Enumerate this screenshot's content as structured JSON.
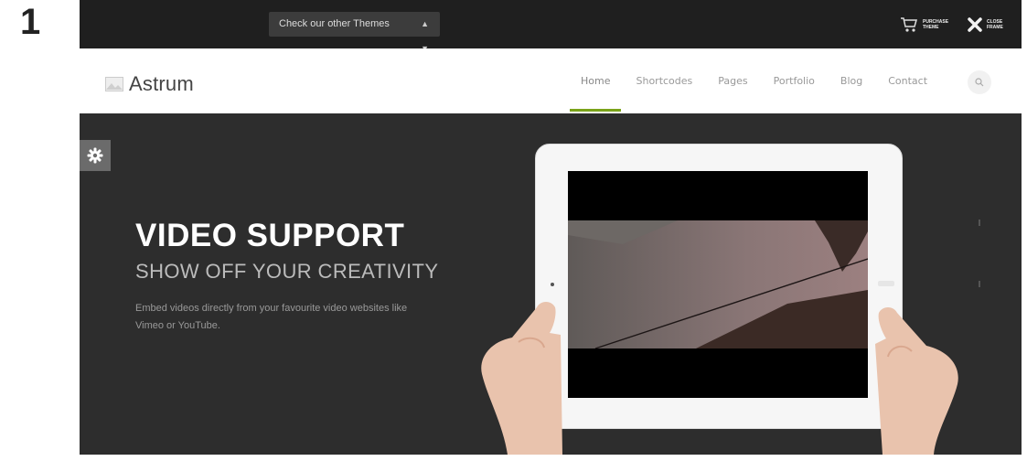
{
  "figure_number": "1",
  "topbar": {
    "theme_select_value": "Check our other Themes",
    "purchase_label": "PURCHASE THEME",
    "close_label": "CLOSE FRAME"
  },
  "header": {
    "logo_text": "Astrum",
    "nav": [
      "Home",
      "Shortcodes",
      "Pages",
      "Portfolio",
      "Blog",
      "Contact"
    ],
    "active_nav": "Home"
  },
  "hero": {
    "title": "VIDEO SUPPORT",
    "subtitle": "SHOW OFF YOUR CREATIVITY",
    "description": "Embed videos directly from your favourite video websites like Vimeo or YouTube."
  },
  "colors": {
    "topbar_bg": "#1f1f1f",
    "hero_bg": "#2d2d2d",
    "accent": "#7aa31a"
  },
  "icons": [
    "cart-icon",
    "close-x-icon",
    "search-icon",
    "gear-icon",
    "image-icon"
  ]
}
